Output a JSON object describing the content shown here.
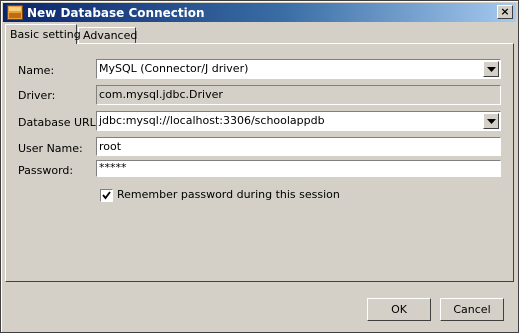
{
  "window": {
    "title": "New Database Connection",
    "icon": "database-app-icon"
  },
  "tabs": [
    {
      "label": "Basic setting",
      "active": true
    },
    {
      "label": "Advanced",
      "active": false
    }
  ],
  "form": {
    "name": {
      "label": "Name:",
      "value": "MySQL (Connector/J driver)"
    },
    "driver": {
      "label": "Driver:",
      "value": "com.mysql.jdbc.Driver"
    },
    "database_url": {
      "label": "Database URL:",
      "value": "jdbc:mysql://localhost:3306/schoolappdb"
    },
    "user_name": {
      "label": "User Name:",
      "value": "root"
    },
    "password": {
      "label": "Password:",
      "value": "*****"
    },
    "remember": {
      "label": "Remember password during this session",
      "checked": true
    }
  },
  "buttons": {
    "ok": "OK",
    "cancel": "Cancel"
  },
  "colors": {
    "title_start": "#0a246a",
    "title_end": "#a6caf0",
    "face": "#d4d0c8"
  }
}
